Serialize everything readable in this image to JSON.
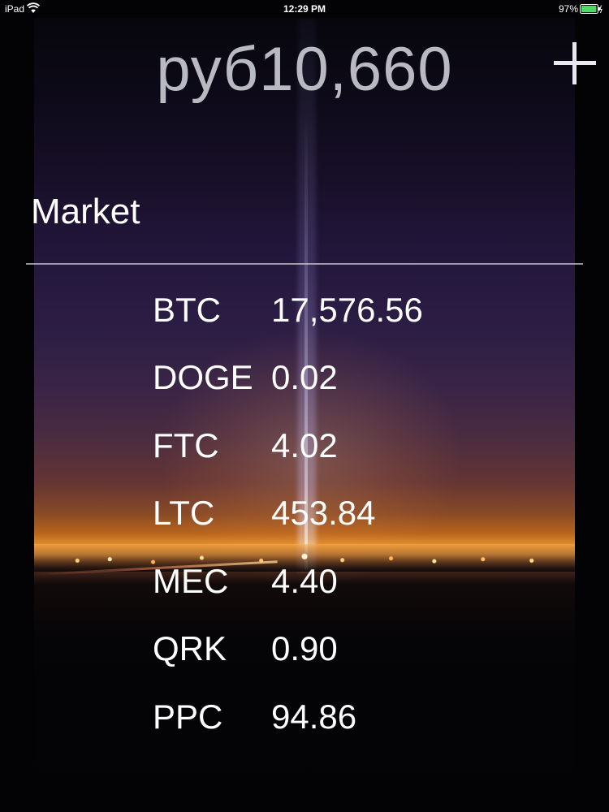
{
  "status_bar": {
    "device": "iPad",
    "time": "12:29 PM",
    "battery_percent": "97%",
    "wifi_icon": "wifi-icon",
    "battery_icon": "battery-charging-icon",
    "battery_level": 0.97
  },
  "header": {
    "balance": "руб10,660",
    "add_icon": "plus-icon"
  },
  "market": {
    "title": "Market",
    "rows": [
      {
        "symbol": "BTC",
        "price": "17,576.56"
      },
      {
        "symbol": "DOGE",
        "price": "0.02"
      },
      {
        "symbol": "FTC",
        "price": "4.02"
      },
      {
        "symbol": "LTC",
        "price": "453.84"
      },
      {
        "symbol": "MEC",
        "price": "4.40"
      },
      {
        "symbol": "QRK",
        "price": "0.90"
      },
      {
        "symbol": "PPC",
        "price": "94.86"
      }
    ]
  },
  "colors": {
    "balance_text": "#b9b9c2",
    "row_text": "#ffffff",
    "battery_fill": "#4cd964"
  }
}
